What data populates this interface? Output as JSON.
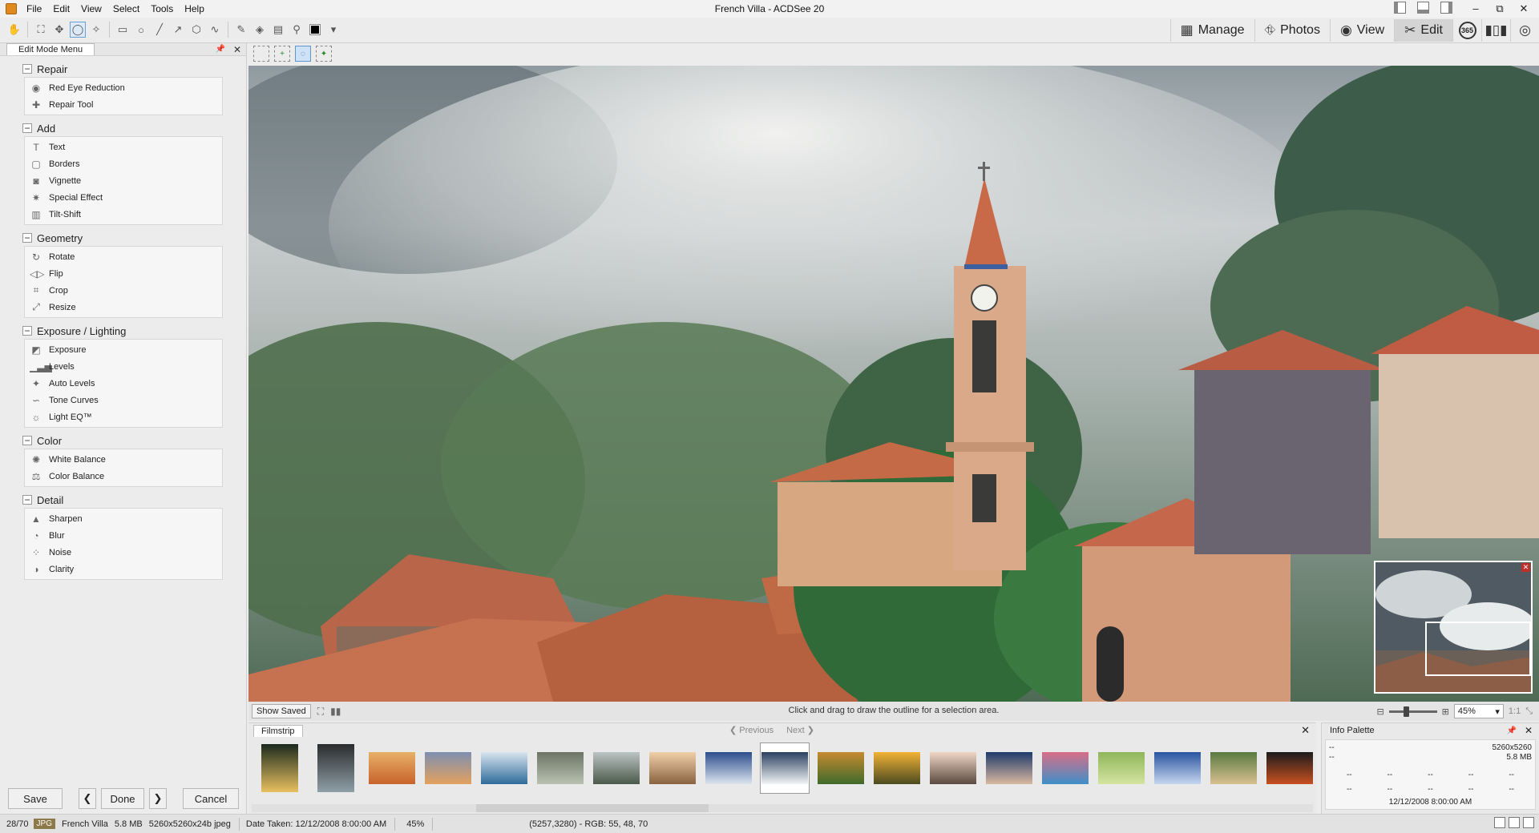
{
  "window": {
    "title": "French Villa - ACDSee 20",
    "controls": [
      "–",
      "⧉",
      "✕"
    ]
  },
  "menu": [
    "File",
    "Edit",
    "View",
    "Select",
    "Tools",
    "Help"
  ],
  "modes": {
    "manage": "Manage",
    "photos": "Photos",
    "view": "View",
    "edit": "Edit",
    "icons": {
      "manage": "grid-icon",
      "photos": "photos-icon",
      "view": "eye-icon",
      "edit": "tools-icon",
      "badge365": "365-icon",
      "histogram": "histogram-icon",
      "share": "share-icon"
    },
    "badge365": "365"
  },
  "panel": {
    "title": "Edit Mode Menu",
    "groups": [
      {
        "label": "Repair",
        "items": [
          {
            "label": "Red Eye Reduction",
            "icon": "eye-icon"
          },
          {
            "label": "Repair Tool",
            "icon": "bandage-icon"
          }
        ]
      },
      {
        "label": "Add",
        "items": [
          {
            "label": "Text",
            "icon": "text-icon"
          },
          {
            "label": "Borders",
            "icon": "borders-icon"
          },
          {
            "label": "Vignette",
            "icon": "vignette-icon"
          },
          {
            "label": "Special Effect",
            "icon": "effect-icon"
          },
          {
            "label": "Tilt-Shift",
            "icon": "tilt-shift-icon"
          }
        ]
      },
      {
        "label": "Geometry",
        "items": [
          {
            "label": "Rotate",
            "icon": "rotate-icon"
          },
          {
            "label": "Flip",
            "icon": "flip-icon"
          },
          {
            "label": "Crop",
            "icon": "crop-icon"
          },
          {
            "label": "Resize",
            "icon": "resize-icon"
          }
        ]
      },
      {
        "label": "Exposure / Lighting",
        "items": [
          {
            "label": "Exposure",
            "icon": "exposure-icon"
          },
          {
            "label": "Levels",
            "icon": "levels-icon"
          },
          {
            "label": "Auto Levels",
            "icon": "auto-levels-icon"
          },
          {
            "label": "Tone Curves",
            "icon": "tone-curves-icon"
          },
          {
            "label": "Light EQ™",
            "icon": "light-eq-icon"
          }
        ]
      },
      {
        "label": "Color",
        "items": [
          {
            "label": "White Balance",
            "icon": "white-balance-icon"
          },
          {
            "label": "Color Balance",
            "icon": "color-balance-icon"
          }
        ]
      },
      {
        "label": "Detail",
        "items": [
          {
            "label": "Sharpen",
            "icon": "sharpen-icon"
          },
          {
            "label": "Blur",
            "icon": "blur-icon"
          },
          {
            "label": "Noise",
            "icon": "noise-icon"
          },
          {
            "label": "Clarity",
            "icon": "clarity-icon"
          }
        ]
      }
    ],
    "footer": {
      "save": "Save",
      "done": "Done",
      "cancel": "Cancel",
      "prev": "❮",
      "next": "❯"
    }
  },
  "image_area": {
    "show_saved": "Show Saved",
    "hint": "Click and drag to draw the outline for a selection area.",
    "zoom": "45%",
    "zoom_ratio_label": "1:1"
  },
  "filmstrip": {
    "title": "Filmstrip",
    "previous": "Previous",
    "next": "Next",
    "thumbnails": [
      {
        "colors": [
          "#1b2a1e",
          "#e8c060"
        ],
        "tall": true
      },
      {
        "colors": [
          "#2a2b2c",
          "#8fa0a8"
        ],
        "tall": true
      },
      {
        "colors": [
          "#e7b067",
          "#c8632c"
        ]
      },
      {
        "colors": [
          "#7d8fb0",
          "#e3a15e"
        ]
      },
      {
        "colors": [
          "#d8e4ee",
          "#2f6b9a"
        ]
      },
      {
        "colors": [
          "#6c7565",
          "#b9c2b1"
        ]
      },
      {
        "colors": [
          "#bcc3c4",
          "#4a5a4a"
        ]
      },
      {
        "colors": [
          "#f0d0a8",
          "#8a6240"
        ]
      },
      {
        "colors": [
          "#2c4d8c",
          "#dce4ef"
        ]
      },
      {
        "colors": [
          "#2a4060",
          "#f2f4f6"
        ]
      },
      {
        "colors": [
          "#c68a30",
          "#3f6a2a"
        ]
      },
      {
        "colors": [
          "#f2b236",
          "#4b4a20"
        ]
      },
      {
        "colors": [
          "#f1d6c6",
          "#5a4a40"
        ]
      },
      {
        "colors": [
          "#1f3b6b",
          "#d9b8a0"
        ]
      },
      {
        "colors": [
          "#d86e86",
          "#3f8fc8"
        ]
      },
      {
        "colors": [
          "#8fb65a",
          "#d4e4a0"
        ]
      },
      {
        "colors": [
          "#2a54a0",
          "#c6d6ee"
        ]
      },
      {
        "colors": [
          "#5a7a40",
          "#d8c090"
        ]
      },
      {
        "colors": [
          "#1c1c1c",
          "#c85020"
        ]
      }
    ]
  },
  "info_palette": {
    "title": "Info Palette",
    "dimensions": "5260x5260",
    "size": "5.8 MB",
    "placeholder": "--",
    "date": "12/12/2008 8:00:00 AM"
  },
  "statusbar": {
    "index": "28/70",
    "type": "JPG",
    "name": "French Villa",
    "size": "5.8 MB",
    "details": "5260x5260x24b jpeg",
    "date_taken": "Date Taken: 12/12/2008 8:00:00 AM",
    "zoom": "45%",
    "coords": "(5257,3280) - RGB: 55, 48, 70"
  }
}
